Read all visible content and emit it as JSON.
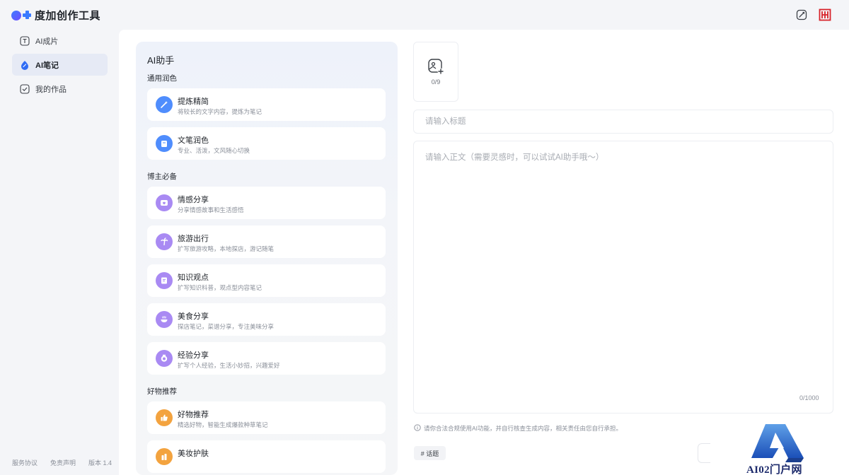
{
  "app": {
    "title": "度加创作工具"
  },
  "header": {
    "icons": [
      "edit-note-icon",
      "brand-seal-icon"
    ]
  },
  "sidebar": {
    "items": [
      {
        "label": "AI成片",
        "icon": "text-box-icon",
        "active": false
      },
      {
        "label": "AI笔记",
        "icon": "note-drop-icon",
        "active": true
      },
      {
        "label": "我的作品",
        "icon": "check-box-icon",
        "active": false
      }
    ],
    "footer": [
      "服务协议",
      "免责声明",
      "版本 1.4"
    ]
  },
  "ai_panel": {
    "title": "AI助手",
    "sections": [
      {
        "label": "通用润色",
        "cards": [
          {
            "title": "提炼精简",
            "desc": "将较长的文字内容，提炼为笔记",
            "icon": "magic-wand-icon",
            "color": "#4f8dfd"
          },
          {
            "title": "文笔润色",
            "desc": "专业、活泼，文风随心切换",
            "icon": "cup-icon",
            "color": "#4f8dfd"
          }
        ]
      },
      {
        "label": "博主必备",
        "cards": [
          {
            "title": "情感分享",
            "desc": "分享情感故事和生活感悟",
            "icon": "heart-chat-icon",
            "color": "#9a7cf0"
          },
          {
            "title": "旅游出行",
            "desc": "扩写旅游攻略，本地探店，游记随笔",
            "icon": "palm-tree-icon",
            "color": "#9a7cf0"
          },
          {
            "title": "知识观点",
            "desc": "扩写知识科普，观点型内容笔记",
            "icon": "book-icon",
            "color": "#9a7cf0"
          },
          {
            "title": "美食分享",
            "desc": "探店笔记，菜谱分享，专注美味分享",
            "icon": "dish-icon",
            "color": "#9a7cf0"
          },
          {
            "title": "经验分享",
            "desc": "扩写个人经验，生活小妙招，兴趣爱好",
            "icon": "badge-icon",
            "color": "#9a7cf0"
          }
        ]
      },
      {
        "label": "好物推荐",
        "cards": [
          {
            "title": "好物推荐",
            "desc": "精选好物，智能生成爆款种草笔记",
            "icon": "thumbs-up-icon",
            "color": "#f3a33f"
          },
          {
            "title": "美妆护肤",
            "desc": "",
            "icon": "cosmetics-icon",
            "color": "#f3a33f"
          }
        ]
      }
    ]
  },
  "editor": {
    "upload_count": "0/9",
    "title_placeholder": "请输入标题",
    "body_placeholder": "请输入正文（需要灵感时，可以试试AI助手哦～）",
    "counter": "0/1000",
    "notice": "请你合法合规使用AI功能，并自行核查生成内容，相关责任由您自行承担。",
    "topic_tag": "# 话题"
  },
  "watermark": {
    "text": "AI02门户网"
  }
}
